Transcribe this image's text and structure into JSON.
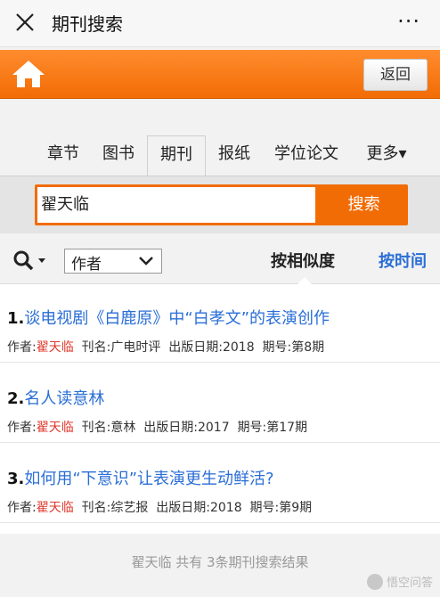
{
  "header": {
    "title": "期刊搜索",
    "more_label": "···"
  },
  "orangebar": {
    "back_label": "返回"
  },
  "tabs": [
    {
      "label": "章节"
    },
    {
      "label": "图书"
    },
    {
      "label": "期刊"
    },
    {
      "label": "报纸"
    },
    {
      "label": "学位论文"
    },
    {
      "label": "更多▾"
    }
  ],
  "search": {
    "value": "翟天临",
    "button_label": "搜索"
  },
  "filter": {
    "field_value": "作者",
    "sort_similarity": "按相似度",
    "sort_time": "按时间"
  },
  "results": [
    {
      "num": "1.",
      "title": "谈电视剧《白鹿原》中“白孝文”的表演创作",
      "author_label": "作者:",
      "author": "翟天临",
      "journal": "刊名:广电时评",
      "date": "出版日期:2018",
      "issue": "期号:第8期"
    },
    {
      "num": "2.",
      "title": "名人读意林",
      "author_label": "作者:",
      "author": "翟天临",
      "journal": "刊名:意林",
      "date": "出版日期:2017",
      "issue": "期号:第17期"
    },
    {
      "num": "3.",
      "title": "如何用“下意识”让表演更生动鲜活?",
      "author_label": "作者:",
      "author": "翟天临",
      "journal": "刊名:综艺报",
      "date": "出版日期:2018",
      "issue": "期号:第9期"
    }
  ],
  "footer": {
    "summary": "翟天临  共有 3条期刊搜索结果",
    "watermark": "悟空问答"
  },
  "colors": {
    "accent": "#f26c05",
    "link": "#2a6ed6",
    "author": "#e0362b"
  }
}
